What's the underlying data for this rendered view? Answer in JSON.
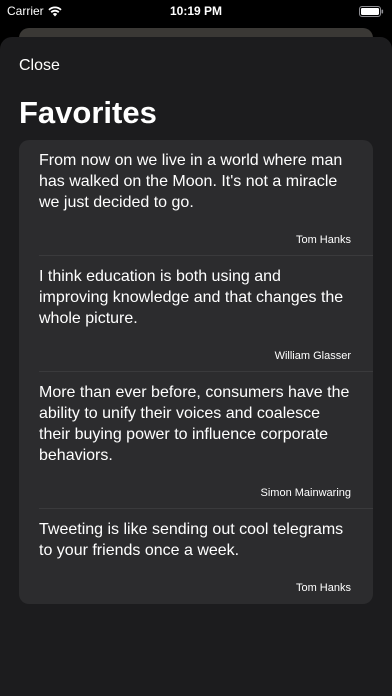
{
  "status_bar": {
    "carrier": "Carrier",
    "time": "10:19 PM"
  },
  "sheet": {
    "close_label": "Close",
    "title": "Favorites"
  },
  "quotes": [
    {
      "text": "From now on we live in a world where man has walked on the Moon. It's not a miracle we just decided to go.",
      "author": "Tom Hanks"
    },
    {
      "text": "I think education is both using and improving knowledge and that changes the whole picture.",
      "author": "William Glasser"
    },
    {
      "text": "More than ever before, consumers have the ability to unify their voices and coalesce their buying power to influence corporate behaviors.",
      "author": "Simon Mainwaring"
    },
    {
      "text": "Tweeting is like sending out cool telegrams to your friends once a week.",
      "author": "Tom Hanks"
    }
  ],
  "colors": {
    "background": "#000000",
    "sheet": "#1c1c1e",
    "list": "#2c2c2e",
    "separator": "#3a3a3c"
  }
}
